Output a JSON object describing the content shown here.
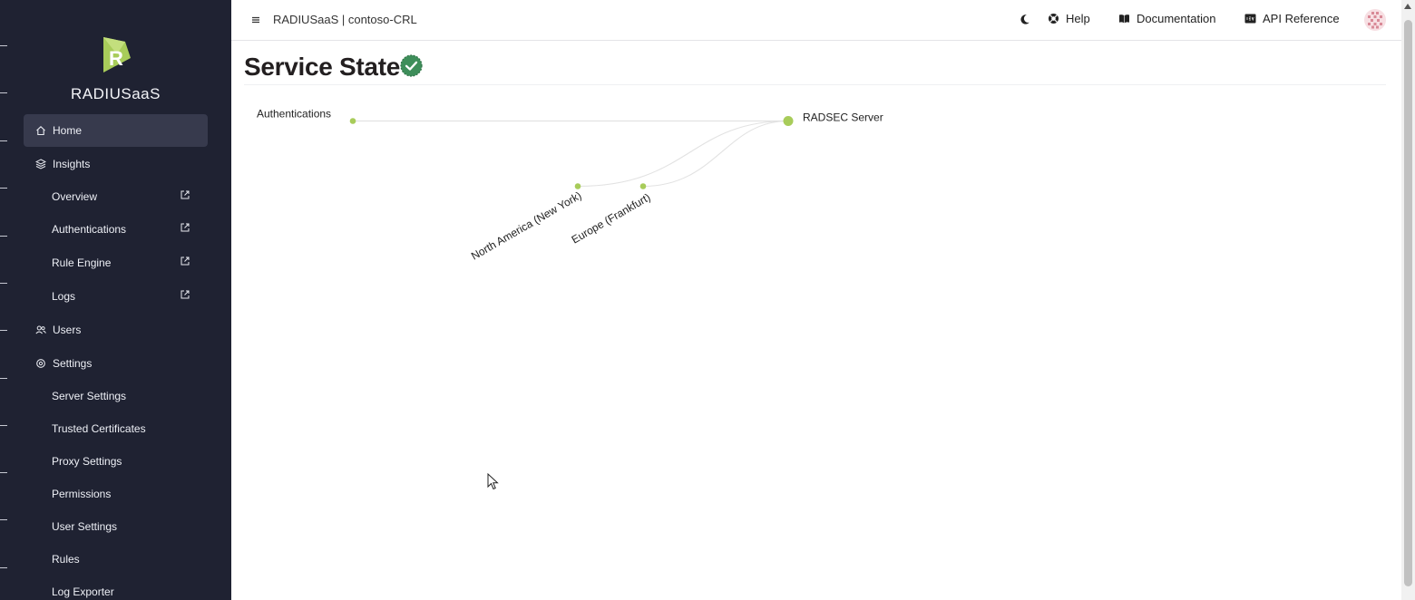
{
  "app": {
    "brand": "RADIUSaaS",
    "title": "RADIUSaaS | contoso-CRL"
  },
  "sidebar": {
    "items": [
      {
        "label": "Home",
        "icon": "home-icon",
        "active": true
      },
      {
        "label": "Insights",
        "icon": "layers-icon"
      },
      {
        "label": "Overview",
        "external": true
      },
      {
        "label": "Authentications",
        "external": true
      },
      {
        "label": "Rule Engine",
        "external": true
      },
      {
        "label": "Logs",
        "external": true
      },
      {
        "label": "Users",
        "icon": "users-icon"
      },
      {
        "label": "Settings",
        "icon": "settings-icon"
      },
      {
        "label": "Server Settings"
      },
      {
        "label": "Trusted Certificates"
      },
      {
        "label": "Proxy Settings"
      },
      {
        "label": "Permissions"
      },
      {
        "label": "User Settings"
      },
      {
        "label": "Rules"
      },
      {
        "label": "Log Exporter"
      }
    ]
  },
  "topbar": {
    "theme_icon": "moon-icon",
    "help": "Help",
    "documentation": "Documentation",
    "api_reference": "API Reference"
  },
  "main": {
    "page_title": "Service State",
    "status_icon": "check-circle-icon",
    "graph": {
      "root": "Authentications",
      "target": "RADSEC Server",
      "regions": [
        "North America (New York)",
        "Europe (Frankfurt)"
      ]
    }
  },
  "colors": {
    "sidebar_bg": "#1f2232",
    "accent_green": "#a8cc5a",
    "status_green": "#3e8e5a"
  }
}
